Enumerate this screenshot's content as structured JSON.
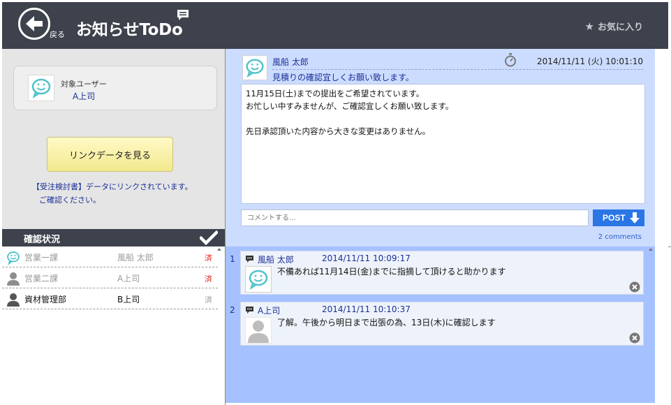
{
  "header": {
    "back_label": "戻る",
    "title": "お知らせToDo",
    "favorite_label": "お気に入り"
  },
  "left": {
    "user_card": {
      "label": "対象ユーザー",
      "name": "A上司"
    },
    "link_button_label": "リンクデータを見る",
    "link_note_line1": "【受注検討書】データにリンクされています。",
    "link_note_line2": "ご確認ください。"
  },
  "status": {
    "title": "確認状況",
    "rows": [
      {
        "dept": "営業一課",
        "person": "風船 太郎",
        "mark": "済",
        "state": "done",
        "icon": "smile-bubble-icon"
      },
      {
        "dept": "営業二課",
        "person": "A上司",
        "mark": "済",
        "state": "done",
        "icon": "person-icon"
      },
      {
        "dept": "資材管理部",
        "person": "B上司",
        "mark": "済",
        "state": "open",
        "icon": "person-icon"
      }
    ]
  },
  "message": {
    "author": "風船 太郎",
    "date": "2014/11/11 (火)  10:01:10",
    "subject": "見積りの確認宜しくお願い致します。",
    "body": [
      "11月15日(土)までの提出をご希望されています。",
      "お忙しい中すみませんが、ご確認宜しくお願い致します。",
      "",
      "先日承認頂いた内容から大きな変更はありません。"
    ],
    "comment_placeholder": "コメントする...",
    "post_label": "POST",
    "comment_count": "2 comments"
  },
  "comments": [
    {
      "num": "1",
      "author": "風船 太郎",
      "date": "2014/11/11 10:09:17",
      "text": "不備あれば11月14日(金)までに指摘して頂けると助かります",
      "avatar": "smile-bubble-icon"
    },
    {
      "num": "2",
      "author": "A上司",
      "date": "2014/11/11 10:10:37",
      "text": "了解。午後から明日まで出張の為、13日(木)に確認します",
      "avatar": "person-icon"
    }
  ],
  "colors": {
    "header_bg": "#3d424c",
    "accent_blue": "#2b76e5",
    "link_text": "#1a2f96",
    "done_mark": "#e2231a"
  }
}
